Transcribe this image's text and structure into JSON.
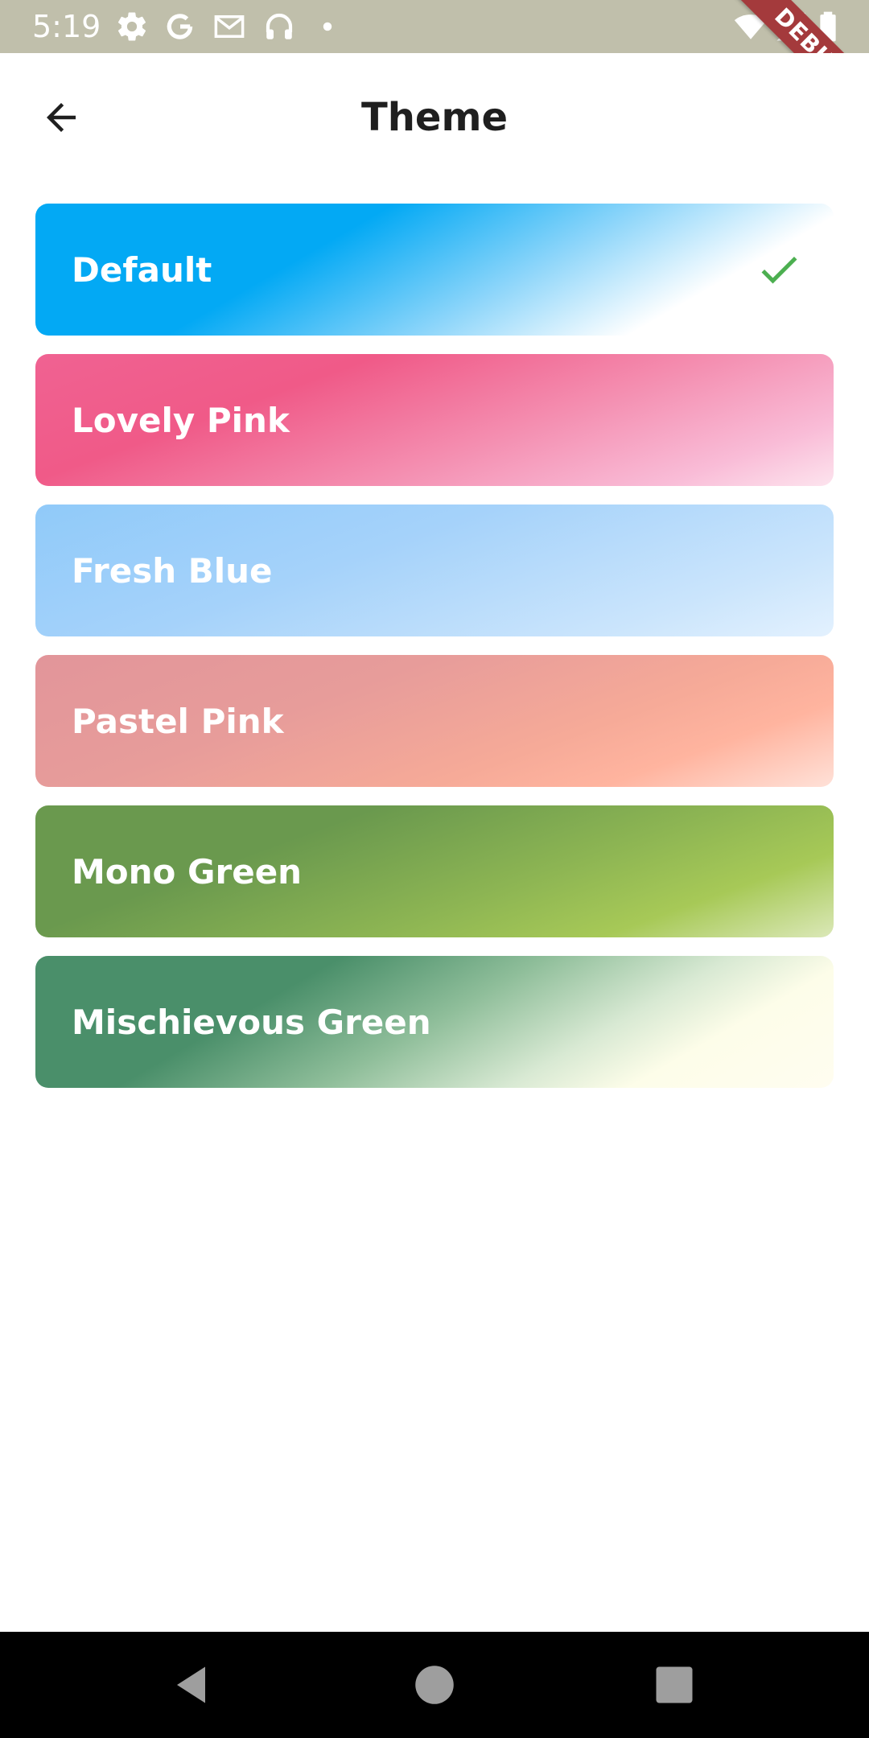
{
  "status_bar": {
    "time": "5:19",
    "icons": [
      "gear-icon",
      "google-icon",
      "gmail-icon",
      "headphones-icon",
      "dot-icon",
      "wifi-icon",
      "signal-icon",
      "battery-icon"
    ],
    "debug_label": "DEBUG"
  },
  "app_bar": {
    "title": "Theme",
    "back_icon": "arrow-back-icon"
  },
  "themes": [
    {
      "label": "Default",
      "selected": true
    },
    {
      "label": "Lovely Pink",
      "selected": false
    },
    {
      "label": "Fresh Blue",
      "selected": false
    },
    {
      "label": "Pastel Pink",
      "selected": false
    },
    {
      "label": "Mono Green",
      "selected": false
    },
    {
      "label": "Mischievous Green",
      "selected": false
    }
  ],
  "colors": {
    "status_bar": "#c0bfab",
    "check": "#4caf50",
    "debug_ribbon": "#a43a3c",
    "nav_icons": "#9e9e9e"
  },
  "nav_bar": {
    "icons": [
      "back-triangle-icon",
      "home-circle-icon",
      "recents-square-icon"
    ]
  }
}
